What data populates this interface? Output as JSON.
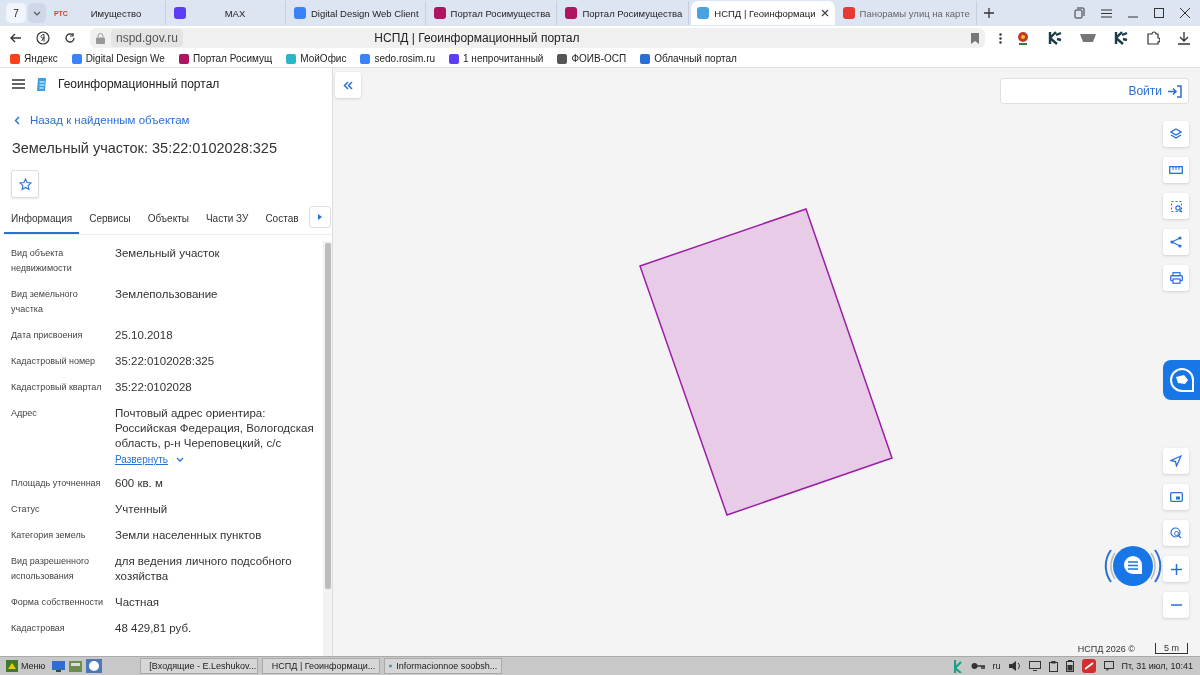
{
  "browser": {
    "tab_count": "7",
    "tabs": [
      {
        "title": "Имущество",
        "icon_text": "РТС",
        "color": "#e53935",
        "selected": false
      },
      {
        "title": "MAX",
        "color": "#5b3df5",
        "selected": false
      },
      {
        "title": "Digital Design Web Client",
        "color": "#3b82f6",
        "selected": false
      },
      {
        "title": "Портал Росимущества",
        "color": "#b0135f",
        "selected": false
      },
      {
        "title": "Портал Росимущества",
        "color": "#b0135f",
        "selected": false
      },
      {
        "title": "НСПД | Геоинформаци",
        "color": "#4aa3df",
        "selected": true
      },
      {
        "title": "Панорамы улиц на карте",
        "color": "#e53935",
        "selected": false
      }
    ],
    "url": "nspd.gov.ru",
    "page_title": "НСПД | Геоинформационный портал",
    "bookmarks": [
      {
        "title": "Яндекс",
        "color": "#fc3f1d"
      },
      {
        "title": "Digital Design We",
        "color": "#3b82f6"
      },
      {
        "title": "Портал Росимущ",
        "color": "#b0135f"
      },
      {
        "title": "МойОфис",
        "color": "#29b6c6"
      },
      {
        "title": "sedo.rosim.ru",
        "color": "#3b82f6"
      },
      {
        "title": "1 непрочитанный",
        "color": "#5b3df5"
      },
      {
        "title": "ФОИВ-ОСП",
        "color": "#555555"
      },
      {
        "title": "Облачный портал",
        "color": "#2a6fd6"
      }
    ]
  },
  "panel": {
    "app_title": "Геоинформационный портал",
    "back_link": "Назад к найденным объектам",
    "heading": "Земельный участок: 35:22:0102028:325",
    "tabs": [
      {
        "label": "Информация",
        "selected": true
      },
      {
        "label": "Сервисы",
        "selected": false
      },
      {
        "label": "Объекты",
        "selected": false
      },
      {
        "label": "Части ЗУ",
        "selected": false
      },
      {
        "label": "Состав",
        "selected": false
      }
    ],
    "fields": [
      {
        "label": "Вид объекта недвижимости",
        "value": "Земельный участок"
      },
      {
        "label": "Вид земельного участка",
        "value": "Землепользование"
      },
      {
        "label": "Дата присвоения",
        "value": "25.10.2018"
      },
      {
        "label": "Кадастровый номер",
        "value": "35:22:0102028:325"
      },
      {
        "label": "Кадастровый квартал",
        "value": "35:22:0102028"
      },
      {
        "label": "Адрес",
        "value": "Почтовый адрес ориентира: Российская Федерация, Вологодская область, р-н Череповецкий, с/с",
        "expand_link": "Развернуть"
      },
      {
        "label": "Площадь уточненная",
        "value": "600 кв. м"
      },
      {
        "label": "Статус",
        "value": "Учтенный"
      },
      {
        "label": "Категория земель",
        "value": "Земли населенных пунктов"
      },
      {
        "label": "Вид разрешенного использования",
        "value": "для ведения личного подсобного хозяйства"
      },
      {
        "label": "Форма собственности",
        "value": "Частная"
      },
      {
        "label": "Кадастровая",
        "value": "48 429,81 руб."
      }
    ]
  },
  "map": {
    "login": "Войти",
    "attribution": "НСПД 2026 ©",
    "scale": "5 m"
  },
  "taskbar": {
    "menu": "Меню",
    "windows": [
      {
        "title": "[Входящие - E.Leshukov..."
      },
      {
        "title": "НСПД | Геоинформаци..."
      },
      {
        "title": "Informacionnoe soobsh..."
      }
    ],
    "language": "ru",
    "clock": "Пт, 31 июл, 10:41"
  }
}
